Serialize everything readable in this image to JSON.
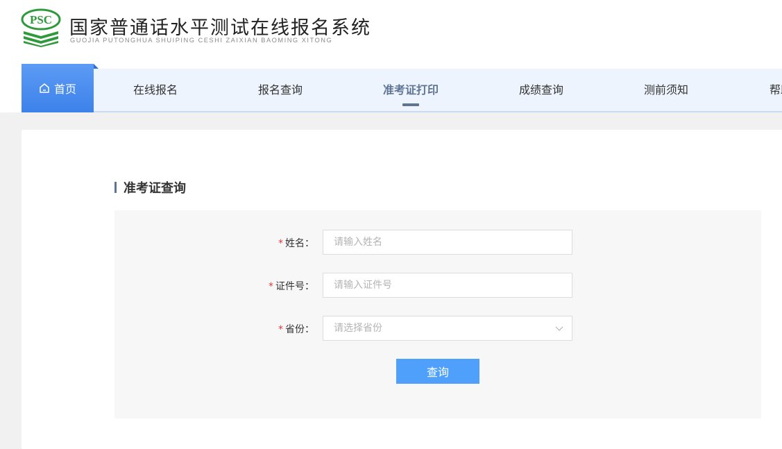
{
  "header": {
    "logo_text": "PSC",
    "title": "国家普通话水平测试在线报名系统",
    "subtitle": "GUOJIA PUTONGHUA SHUIPING CESHI ZAIXIAN BAOMING XITONG"
  },
  "nav": {
    "home_label": "首页",
    "items": [
      {
        "label": "在线报名"
      },
      {
        "label": "报名查询"
      },
      {
        "label": "准考证打印"
      },
      {
        "label": "成绩查询"
      },
      {
        "label": "测前须知"
      },
      {
        "label": "帮助"
      }
    ],
    "active_index": 2
  },
  "section": {
    "title": "准考证查询"
  },
  "form": {
    "required_mark": "*",
    "name_label": "姓名：",
    "name_placeholder": "请输入姓名",
    "id_label": "证件号：",
    "id_placeholder": "请输入证件号",
    "province_label": "省份：",
    "province_placeholder": "请选择省份",
    "submit_label": "查询"
  },
  "colors": {
    "accent": "#4ea0fb",
    "nav_home": "#3d82ea",
    "active_nav": "#5f7494",
    "required": "#e4393c",
    "logo_green": "#2f9a3c"
  }
}
